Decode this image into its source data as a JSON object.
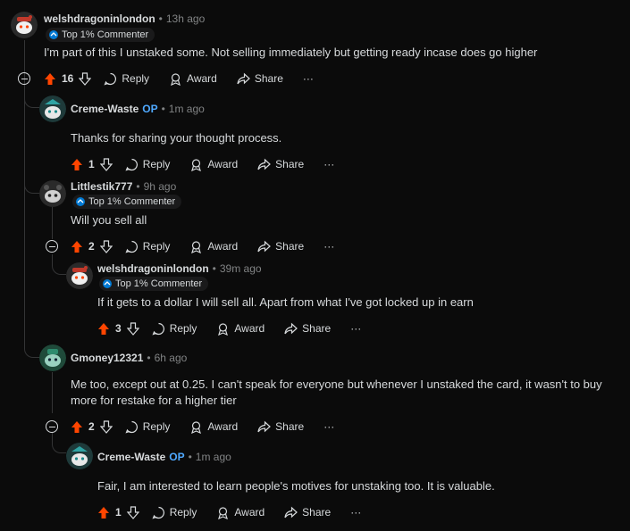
{
  "colors": {
    "background": "#0b0b0b",
    "upvote": "#ff4500",
    "op": "#4fa9ff",
    "muted": "#818384",
    "text": "#d7dadc"
  },
  "actions": {
    "reply": "Reply",
    "award": "Award",
    "share": "Share",
    "more": "···"
  },
  "comments": [
    {
      "username": "welshdragoninlondon",
      "time": "13h ago",
      "badge": "Top 1% Commenter",
      "text": "I'm part of this I unstaked some. Not selling immediately but getting ready incase does go higher",
      "score": "16",
      "upvoted": true
    },
    {
      "username": "Creme-Waste",
      "op": "OP",
      "time": "1m ago",
      "text": "Thanks for sharing your thought process.",
      "score": "1",
      "upvoted": true
    },
    {
      "username": "Littlestik777",
      "time": "9h ago",
      "badge": "Top 1% Commenter",
      "text": "Will you sell all",
      "score": "2",
      "upvoted": true
    },
    {
      "username": "welshdragoninlondon",
      "time": "39m ago",
      "badge": "Top 1% Commenter",
      "text": "If it gets to a dollar I will sell all. Apart from what I've got locked up in earn",
      "score": "3",
      "upvoted": true
    },
    {
      "username": "Gmoney12321",
      "time": "6h ago",
      "text_line1": "Me too, except out at 0.25. I can't speak for everyone but whenever I unstaked the card, it wasn't to buy",
      "text_line2": "more for restake for a higher tier",
      "score": "2",
      "upvoted": true
    },
    {
      "username": "Creme-Waste",
      "op": "OP",
      "time": "1m ago",
      "text": "Fair, I am interested to learn people's motives for unstaking too. It is valuable.",
      "score": "1",
      "upvoted": true
    }
  ]
}
